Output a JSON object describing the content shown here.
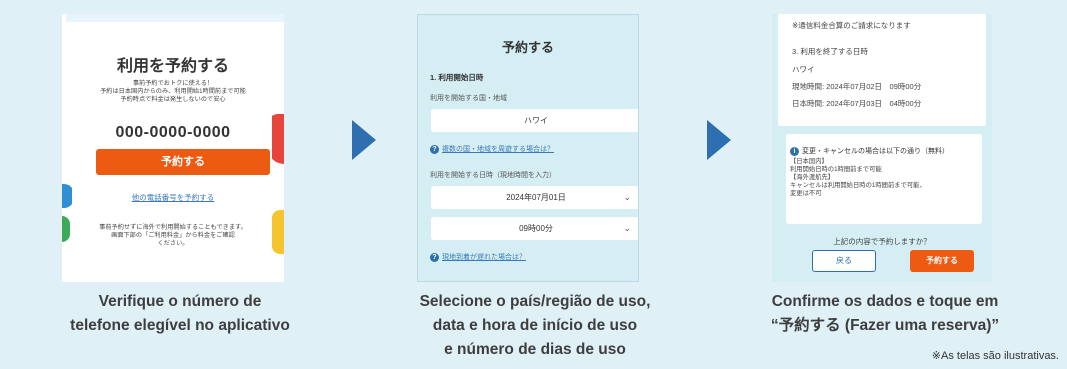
{
  "screen1": {
    "title": "利用を予約する",
    "info_lines": [
      "事前予約でおトクに使える！",
      "予約は日本国内からのみ、利用開始1時間前まで可能",
      "予約時点で料金は発生しないので安心"
    ],
    "phone": "000-0000-0000",
    "reserve_button": "予約する",
    "other_number_link": "他の電話番号を予約する",
    "footer_lines": [
      "事前予約せずに海外で利用開始することもできます。",
      "画面下部の「ご利用料金」から料金をご確認",
      "ください。"
    ]
  },
  "screen2": {
    "title": "予約する",
    "section": "1. 利用開始日時",
    "country_label": "利用を開始する国・地域",
    "country_value": "ハワイ",
    "multi_country_link": "複数の国・地域を周遊する場合は？",
    "datetime_label": "利用を開始する日時（現地時間を入力）",
    "date_value": "2024年07月01日",
    "time_value": "09時00分",
    "late_arrival_link": "現地到着が遅れた場合は？"
  },
  "screen3": {
    "billing_note": "※通信料金合算のご請求になります",
    "end_section": "3. 利用を終了する日時",
    "region": "ハワイ",
    "local_time": "現地時間: 2024年07月02日　09時00分",
    "japan_time": "日本時間: 2024年07月03日　04時00分",
    "cancel_head": "変更・キャンセルの場合は以下の通り（無料）",
    "cancel_lines": [
      "【日本国内】",
      "利用開始日時の1時間前まで可能",
      "【海外渡航先】",
      "キャンセルは利用開始日時の1時間前まで可能、",
      "変更は不可"
    ],
    "confirm_question": "上記の内容で予約しますか？",
    "back_button": "戻る",
    "reserve_button": "予約する"
  },
  "captions": [
    [
      "Verifique o número de",
      "telefone elegível no aplicativo"
    ],
    [
      "Selecione o país/região de uso,",
      "data e hora de início de uso",
      "e número de dias de uso"
    ],
    [
      "Confirme os dados e toque em",
      "“予約する (Fazer uma reserva)”"
    ]
  ],
  "footnote": "※As telas são ilustrativas.",
  "colors": {
    "accent": "#ed5a11",
    "link": "#3a7ab8",
    "arrow": "#2d6fb0",
    "background": "#dff0f6"
  }
}
